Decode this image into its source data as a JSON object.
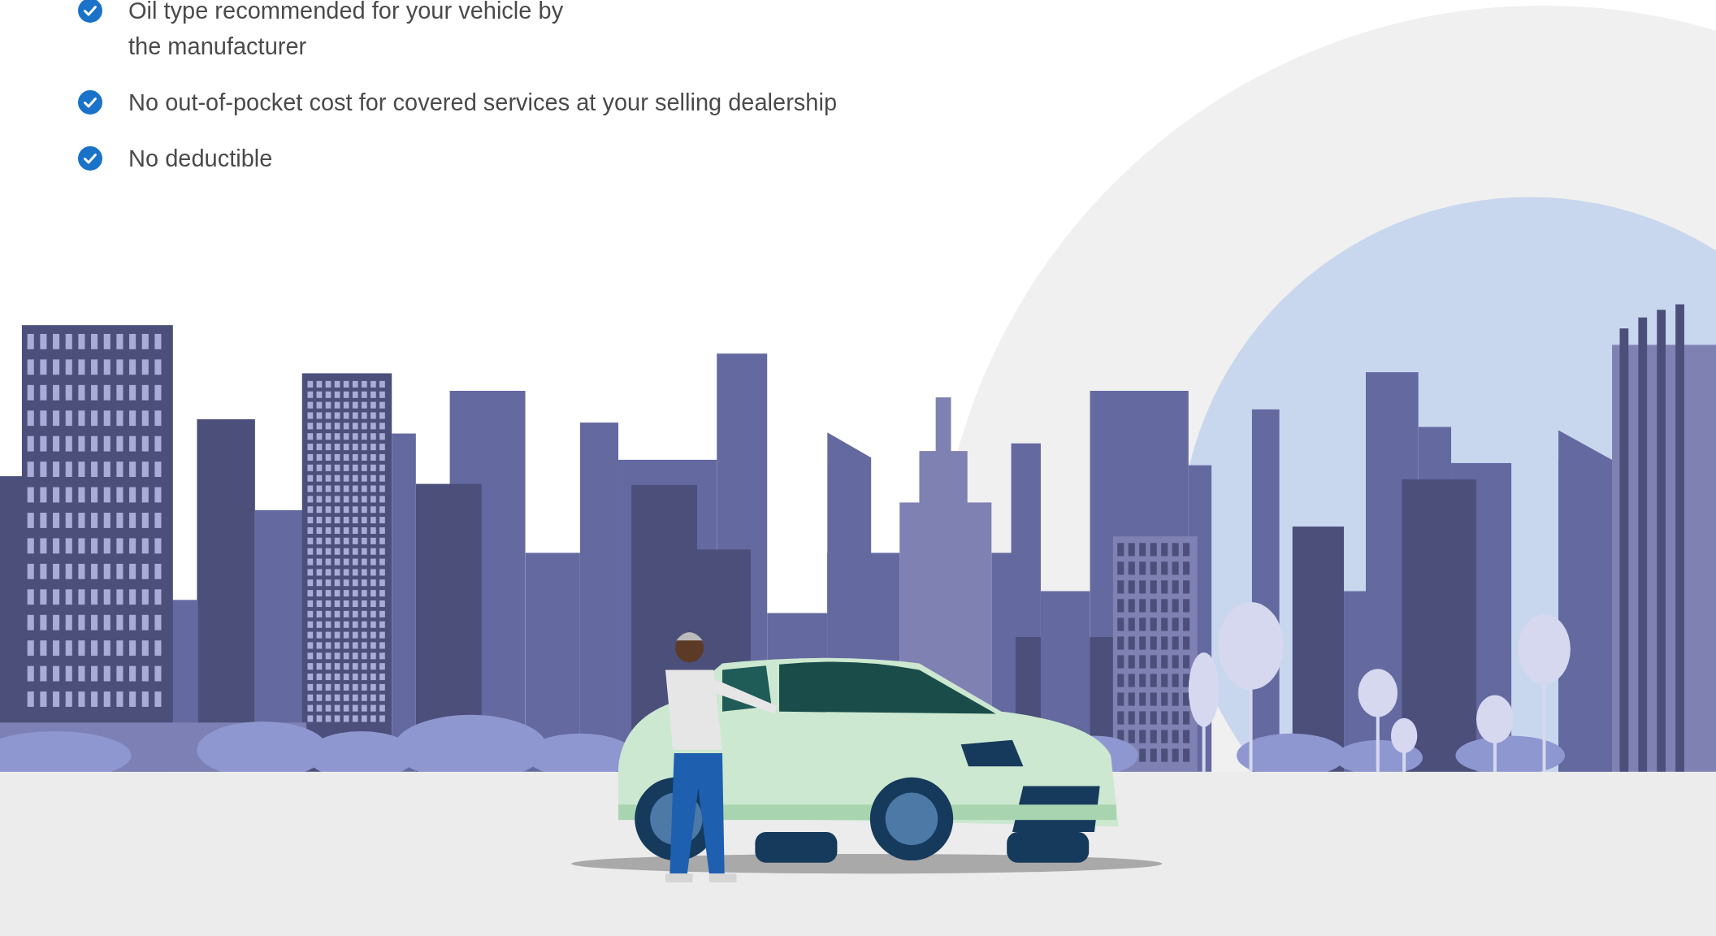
{
  "benefits": [
    {
      "text": "Oil type recommended for your vehicle by\nthe manufacturer",
      "checked": true
    },
    {
      "text": "No out-of-pocket cost for covered services at your selling dealership",
      "checked": true
    },
    {
      "text": "No deductible",
      "checked": true
    }
  ]
}
